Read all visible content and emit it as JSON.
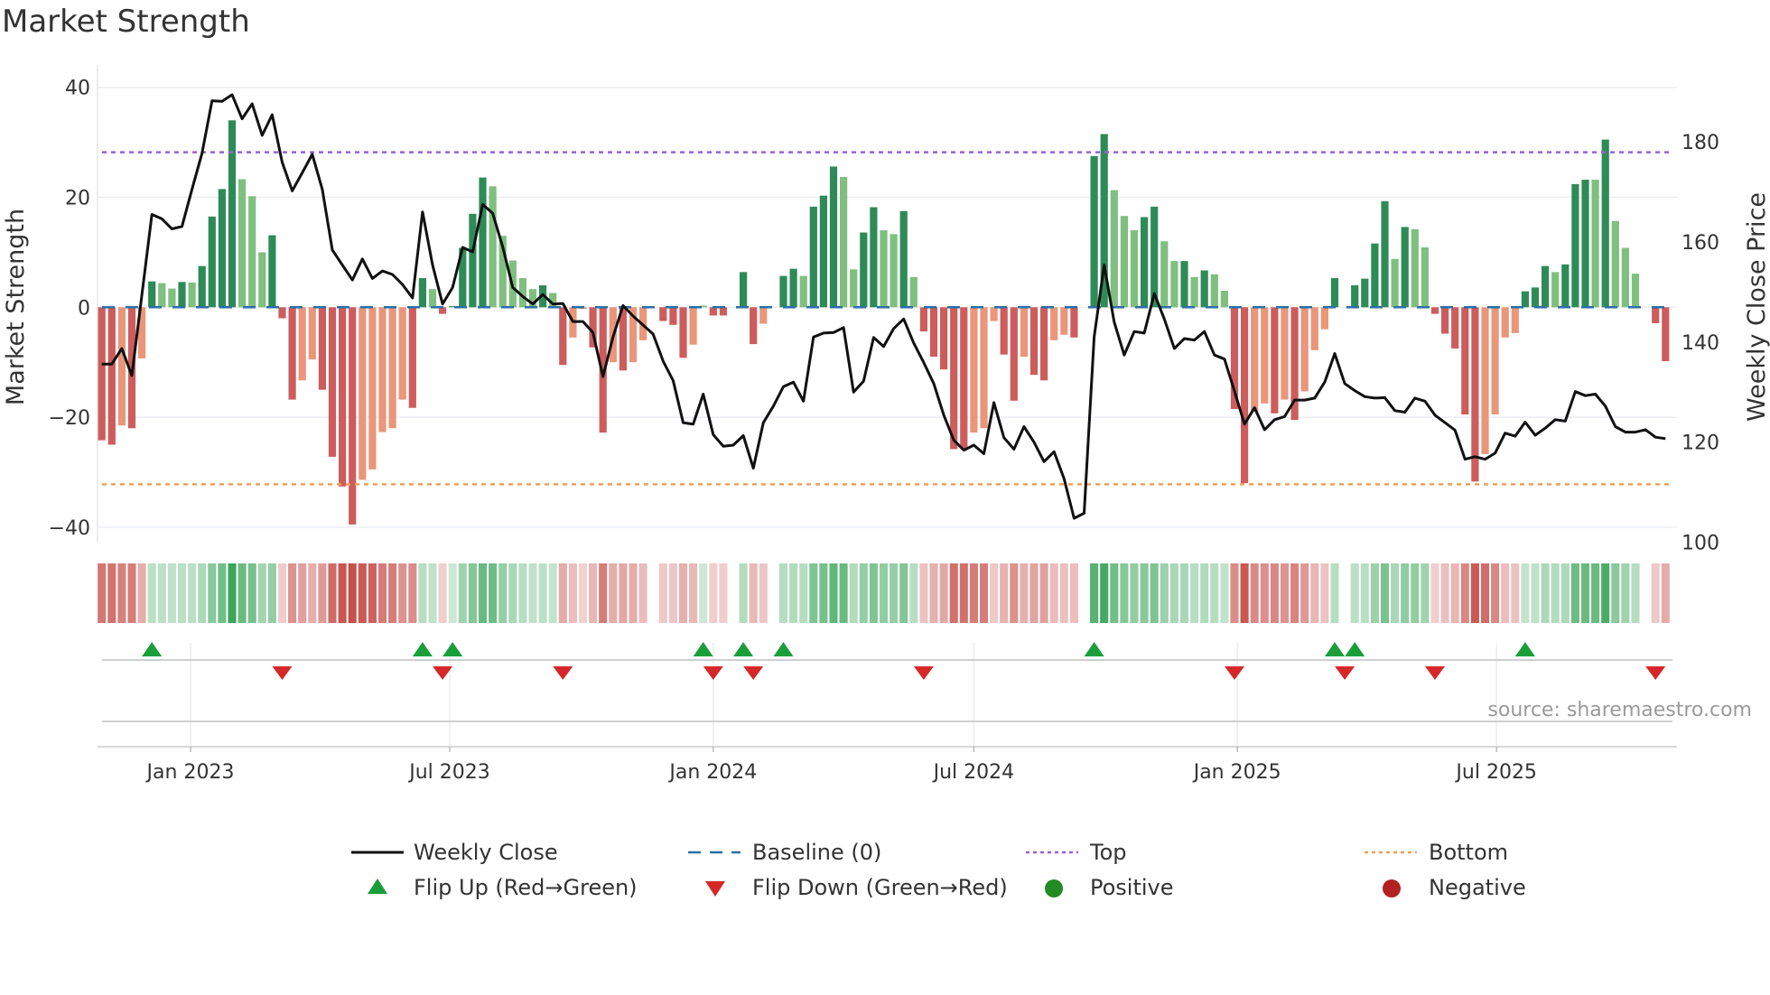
{
  "title": "Market Strength",
  "source": "source: sharemaestro.com",
  "legend": {
    "weekly_close": "Weekly Close",
    "baseline": "Baseline (0)",
    "top": "Top",
    "bottom": "Bottom",
    "flip_up": "Flip Up (Red→Green)",
    "flip_down": "Flip Down (Green→Red)",
    "positive": "Positive",
    "negative": "Negative"
  },
  "colors": {
    "strong_green": "#2e8b57",
    "weak_green": "#7fbf7f",
    "strong_red": "#cd5c5c",
    "weak_red": "#e9967a",
    "line": "#111111",
    "baseline": "#2a6fa8",
    "top": "#9b5fd6",
    "bottom": "#f0a055",
    "flip_up": "#1a9e3a",
    "flip_down": "#d62728",
    "positive": "#228b22",
    "negative": "#b22222"
  },
  "chart_data": {
    "type": "bar",
    "title": "Market Strength",
    "ylabel": "Market Strength",
    "y2label": "Weekly Close Price",
    "ylim": [
      -42.75,
      42.75
    ],
    "y2lim": [
      100,
      193.9
    ],
    "yticks": [
      -40,
      -20,
      0,
      20,
      40
    ],
    "ytick_labels": [
      "−40",
      "−20",
      "0",
      "20",
      "40"
    ],
    "y2ticks": [
      100,
      120,
      140,
      160,
      180
    ],
    "y2tick_labels": [
      "100",
      "120",
      "140",
      "160",
      "180"
    ],
    "xticks": [
      {
        "date": "2023-01-01",
        "label": "Jan 2023"
      },
      {
        "date": "2023-07-01",
        "label": "Jul 2023"
      },
      {
        "date": "2024-01-01",
        "label": "Jan 2024"
      },
      {
        "date": "2024-07-01",
        "label": "Jul 2024"
      },
      {
        "date": "2025-01-01",
        "label": "Jan 2025"
      },
      {
        "date": "2025-07-01",
        "label": "Jul 2025"
      }
    ],
    "start_date": "2022-10-31",
    "frequency": "weekly",
    "top_level": 28.2,
    "bottom_level": -32.2,
    "baseline": 0,
    "strength": [
      -24.2,
      -25,
      -21.5,
      -22,
      -9.3,
      4.7,
      4.4,
      3.4,
      4.6,
      4.5,
      7.5,
      16.5,
      21.5,
      34,
      23.3,
      20.2,
      10,
      13.1,
      -2,
      -16.8,
      -13.3,
      -9.5,
      -15,
      -27.2,
      -32.6,
      -39.5,
      -31.4,
      -29.5,
      -22.7,
      -22,
      -16.8,
      -18.3,
      5.3,
      3.3,
      -1.2,
      0.2,
      10.8,
      17,
      23.6,
      22,
      13,
      8.5,
      5.3,
      3.3,
      4,
      2.6,
      -10.5,
      -5.5,
      -0.3,
      -7.3,
      -22.8,
      -10,
      -11.5,
      -10,
      -6,
      0,
      -2.5,
      -3.2,
      -9.2,
      -6.8,
      0.3,
      -1.5,
      -1.5,
      0,
      6.4,
      -6.7,
      -3,
      0,
      5.7,
      7,
      5.7,
      18.3,
      20.3,
      25.6,
      23.7,
      6.9,
      13.6,
      18.2,
      14,
      13.3,
      17.5,
      5.5,
      -4.4,
      -9,
      -11.3,
      -25.8,
      -25.8,
      -22.8,
      -22,
      -2.5,
      -8.6,
      -17,
      -9,
      -12.3,
      -13.3,
      -6,
      -5,
      -5.5,
      0,
      27.5,
      31.5,
      21.3,
      16.6,
      14,
      16.4,
      18.3,
      12,
      8.4,
      8.4,
      5.5,
      6.7,
      6,
      3,
      -18.5,
      -32,
      -19,
      -17.5,
      -19.3,
      -16.8,
      -20.5,
      -15.3,
      -7.8,
      -4,
      5.3,
      0,
      4,
      5.2,
      11.6,
      19.3,
      8.8,
      14.6,
      14.2,
      10.9,
      -1.2,
      -4.8,
      -7.5,
      -19.5,
      -31.7,
      -26.7,
      -19.5,
      -5.5,
      -4.7,
      2.9,
      3.6,
      7.5,
      6.4,
      7.8,
      22.4,
      23.2,
      23.2,
      30.5,
      15.7,
      10.8,
      6.1,
      0,
      -2.9,
      -9.8
    ],
    "strong": [
      1,
      1,
      0,
      1,
      0,
      1,
      0,
      0,
      1,
      0,
      1,
      1,
      1,
      1,
      0,
      0,
      0,
      1,
      1,
      1,
      0,
      0,
      1,
      1,
      1,
      1,
      0,
      0,
      0,
      0,
      0,
      1,
      1,
      0,
      1,
      1,
      1,
      1,
      1,
      0,
      0,
      0,
      0,
      0,
      1,
      0,
      1,
      0,
      0,
      1,
      1,
      0,
      1,
      0,
      0,
      0,
      1,
      1,
      1,
      0,
      0,
      1,
      1,
      1,
      1,
      1,
      0,
      1,
      1,
      1,
      0,
      1,
      1,
      1,
      0,
      0,
      1,
      1,
      0,
      0,
      1,
      0,
      1,
      1,
      1,
      1,
      1,
      0,
      0,
      0,
      1,
      1,
      0,
      1,
      1,
      0,
      0,
      1,
      1,
      1,
      1,
      0,
      0,
      0,
      1,
      1,
      0,
      0,
      1,
      0,
      1,
      0,
      0,
      1,
      1,
      0,
      0,
      1,
      0,
      1,
      0,
      0,
      0,
      1,
      1,
      1,
      1,
      1,
      1,
      0,
      1,
      0,
      0,
      1,
      1,
      1,
      1,
      1,
      0,
      0,
      0,
      0,
      1,
      1,
      1,
      0,
      1,
      1,
      1,
      0,
      1,
      0,
      0,
      0,
      1,
      1,
      1
    ],
    "weekly_close": [
      135.6,
      135.6,
      138.7,
      133.3,
      149.4,
      165.5,
      164.6,
      162.6,
      163.1,
      170.5,
      177.7,
      188.2,
      188.1,
      189.4,
      184.6,
      187.6,
      181.3,
      185.4,
      175.9,
      170.2,
      173.8,
      177.5,
      170.5,
      158.4,
      155.4,
      152.4,
      156.6,
      152.7,
      154.2,
      153.5,
      151.5,
      148.8,
      166,
      155.4,
      147.6,
      150.9,
      158.9,
      158,
      167.5,
      165.7,
      159,
      150.9,
      149.1,
      147.6,
      149.5,
      147.6,
      147.7,
      144.1,
      144.1,
      141.9,
      133.1,
      141,
      147.3,
      145.2,
      143.4,
      141.6,
      136.2,
      132.3,
      123.9,
      123.6,
      129.6,
      121.5,
      119.2,
      119.4,
      121.3,
      114.8,
      123.9,
      127.2,
      131.1,
      132,
      128.2,
      141,
      141.8,
      141.9,
      142.9,
      130,
      132.2,
      140.9,
      139.1,
      142.7,
      144.6,
      139.8,
      135.9,
      131.7,
      125.4,
      120.4,
      118.4,
      119.4,
      117.7,
      127.9,
      120.9,
      118.6,
      123.1,
      120,
      116.1,
      118.1,
      112.7,
      104.8,
      105.8,
      141,
      155.4,
      144,
      137.4,
      142.1,
      141.8,
      149.7,
      144.6,
      138.7,
      140.7,
      140.4,
      142.1,
      137.4,
      136.6,
      130.2,
      123.6,
      126.9,
      122.5,
      124.5,
      125.1,
      128.4,
      128.4,
      128.8,
      132,
      137.7,
      131.7,
      130.3,
      129.1,
      128.8,
      128.9,
      126.3,
      126,
      128.8,
      128.2,
      125.4,
      123.9,
      122.4,
      116.6,
      117.1,
      116.6,
      117.8,
      121.8,
      121.2,
      124,
      121.4,
      122.8,
      124.5,
      124.2,
      130.1,
      129.3,
      129.6,
      127.2,
      123.1,
      122,
      122,
      122.5,
      121,
      120.7
    ],
    "flip_up_weeks": [
      5,
      32,
      35,
      60,
      64,
      68,
      99,
      123,
      125,
      142
    ],
    "flip_down_weeks": [
      18,
      34,
      46,
      61,
      65,
      82,
      113,
      124,
      133,
      155
    ],
    "legend_position": "bottom"
  }
}
